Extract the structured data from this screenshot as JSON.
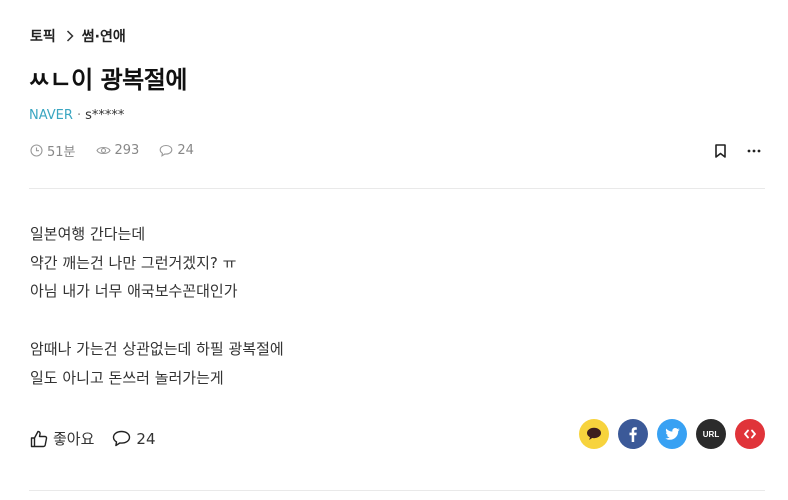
{
  "breadcrumb": {
    "root": "토픽",
    "category": "썸·연애"
  },
  "post": {
    "title": "ㅆㄴ이 광복절에",
    "source": "NAVER",
    "separator": "·",
    "author": "s*****",
    "stats": {
      "time": "51분",
      "views": "293",
      "comments": "24"
    },
    "body": [
      "일본여행 간다는데",
      "약간 깨는건 나만 그런거겠지? ㅠ",
      "아님 내가 너무 애국보수꼰대인가",
      "",
      "암때나 가는건 상관없는데 하필 광복절에",
      "일도 아니고 돈쓰러 놀러가는게"
    ]
  },
  "reactions": {
    "like_label": "좋아요",
    "comment_count": "24"
  },
  "share": {
    "url_label": "URL"
  },
  "icons": [
    "chevron-right-icon",
    "clock-icon",
    "eye-icon",
    "comment-icon",
    "bookmark-icon",
    "more-icon",
    "thumbs-up-icon",
    "kakao-icon",
    "facebook-icon",
    "twitter-icon",
    "url-icon",
    "embed-icon"
  ],
  "colors": {
    "source": "#3aa6c1",
    "kakao": "#f7d33d",
    "facebook": "#3b5998",
    "twitter": "#38a1f3",
    "url": "#2b2b2b",
    "embed": "#e0343a",
    "divider": "#e9e9e9"
  }
}
